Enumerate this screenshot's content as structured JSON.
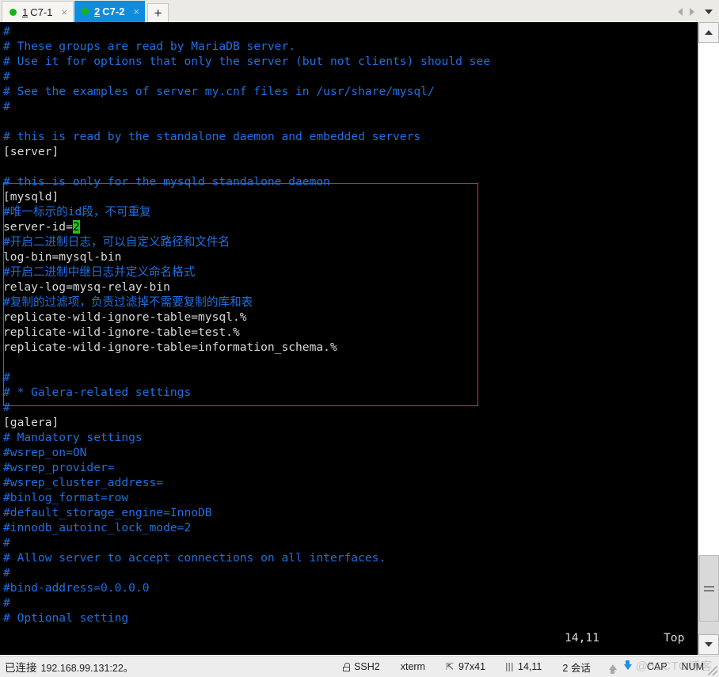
{
  "window": {
    "tabs": [
      {
        "number": "1",
        "label": "C7-1",
        "close": "×",
        "active": false,
        "dot_color": "#15b515"
      },
      {
        "number": "2",
        "label": "C7-2",
        "close": "×",
        "active": true,
        "dot_color": "#15b515"
      }
    ],
    "new_tab_label": "+",
    "nav": {
      "prev": "◀",
      "next": "▶",
      "list": "▼"
    }
  },
  "terminal": {
    "lines": [
      {
        "text": "#",
        "color": "comment"
      },
      {
        "text": "# These groups are read by MariaDB server.",
        "color": "comment"
      },
      {
        "text": "# Use it for options that only the server (but not clients) should see",
        "color": "comment"
      },
      {
        "text": "#",
        "color": "comment"
      },
      {
        "text": "# See the examples of server my.cnf files in /usr/share/mysql/",
        "color": "comment"
      },
      {
        "text": "#",
        "color": "comment"
      },
      {
        "text": "",
        "color": "comment"
      },
      {
        "text": "# this is read by the standalone daemon and embedded servers",
        "color": "comment"
      },
      {
        "text": "[server]",
        "color": "plain"
      },
      {
        "text": "",
        "color": "comment"
      },
      {
        "text": "# this is only for the mysqld standalone daemon",
        "color": "comment"
      },
      {
        "text": "[mysqld]",
        "color": "plain"
      },
      {
        "text": "#唯一标示的id段，不可重复",
        "color": "comment"
      },
      {
        "text": "server-id=",
        "color": "plain",
        "cursor": "2"
      },
      {
        "text": "#开启二进制日志，可以自定义路径和文件名",
        "color": "comment"
      },
      {
        "text": "log-bin=mysql-bin",
        "color": "plain"
      },
      {
        "text": "#开启二进制中继日志并定义命名格式",
        "color": "comment"
      },
      {
        "text": "relay-log=mysq-relay-bin",
        "color": "plain"
      },
      {
        "text": "#复制的过滤项，负责过滤掉不需要复制的库和表",
        "color": "comment"
      },
      {
        "text": "replicate-wild-ignore-table=mysql.%",
        "color": "plain"
      },
      {
        "text": "replicate-wild-ignore-table=test.%",
        "color": "plain"
      },
      {
        "text": "replicate-wild-ignore-table=information_schema.%",
        "color": "plain"
      },
      {
        "text": "",
        "color": "comment"
      },
      {
        "text": "#",
        "color": "comment"
      },
      {
        "text": "# * Galera-related settings",
        "color": "comment"
      },
      {
        "text": "#",
        "color": "comment"
      },
      {
        "text": "[galera]",
        "color": "plain"
      },
      {
        "text": "# Mandatory settings",
        "color": "comment"
      },
      {
        "text": "#wsrep_on=ON",
        "color": "comment"
      },
      {
        "text": "#wsrep_provider=",
        "color": "comment"
      },
      {
        "text": "#wsrep_cluster_address=",
        "color": "comment"
      },
      {
        "text": "#binlog_format=row",
        "color": "comment"
      },
      {
        "text": "#default_storage_engine=InnoDB",
        "color": "comment"
      },
      {
        "text": "#innodb_autoinc_lock_mode=2",
        "color": "comment"
      },
      {
        "text": "#",
        "color": "comment"
      },
      {
        "text": "# Allow server to accept connections on all interfaces.",
        "color": "comment"
      },
      {
        "text": "#",
        "color": "comment"
      },
      {
        "text": "#bind-address=0.0.0.0",
        "color": "comment"
      },
      {
        "text": "#",
        "color": "comment"
      },
      {
        "text": "# Optional setting",
        "color": "comment"
      }
    ],
    "vi_status": {
      "position": "14,11",
      "scroll": "Top"
    },
    "colors": {
      "background": "#000000",
      "comment": "#1f6fe0",
      "plain": "#d8d8d8",
      "cursor_bg": "#19c819"
    },
    "annotation_box_color": "#e3342f"
  },
  "scrollbar": {
    "up_arrow": "▲",
    "down_arrow": "▼"
  },
  "statusbar": {
    "connection_prefix": "已连接",
    "connection_address": "192.168.99.131:22。",
    "protocol": "SSH2",
    "emulation": "xterm",
    "size": "97x41",
    "cursor_position": "14,11",
    "sessions": "2 会话",
    "cap": "CAP",
    "num": "NUM",
    "watermark": "@51CTO博客"
  }
}
